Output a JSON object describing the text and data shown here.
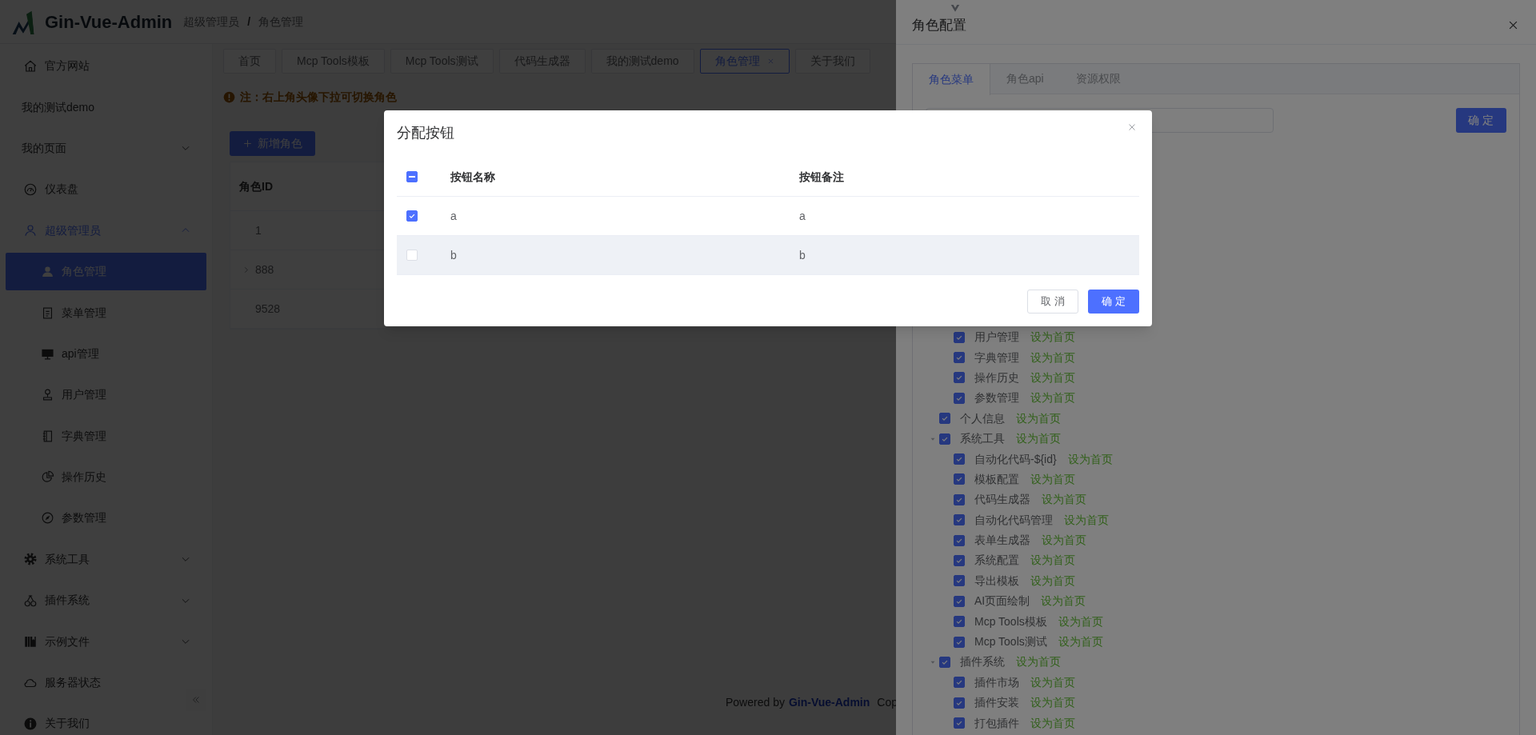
{
  "header": {
    "app_name": "Gin-Vue-Admin",
    "breadcrumb": [
      "超级管理员",
      "角色管理"
    ],
    "separator": "/"
  },
  "sidebar": {
    "items": [
      {
        "label": "官方网站"
      },
      {
        "label": "我的测试demo"
      },
      {
        "label": "我的页面",
        "expanded": false
      },
      {
        "label": "仪表盘"
      },
      {
        "label": "超级管理员",
        "expanded": true,
        "children": [
          {
            "label": "角色管理",
            "selected": true
          },
          {
            "label": "菜单管理",
            "selected": false
          },
          {
            "label": "api管理",
            "selected": false
          },
          {
            "label": "用户管理",
            "selected": false
          },
          {
            "label": "字典管理",
            "selected": false
          },
          {
            "label": "操作历史",
            "selected": false
          },
          {
            "label": "参数管理",
            "selected": false
          }
        ]
      },
      {
        "label": "系统工具",
        "expanded": false
      },
      {
        "label": "插件系统",
        "expanded": false
      },
      {
        "label": "示例文件",
        "expanded": false
      },
      {
        "label": "服务器状态"
      },
      {
        "label": "关于我们"
      }
    ]
  },
  "tabs": [
    {
      "label": "首页",
      "selected": false,
      "closable": false
    },
    {
      "label": "Mcp Tools模板",
      "selected": false,
      "closable": false
    },
    {
      "label": "Mcp Tools测试",
      "selected": false,
      "closable": false
    },
    {
      "label": "代码生成器",
      "selected": false,
      "closable": false
    },
    {
      "label": "我的测试demo",
      "selected": false,
      "closable": false
    },
    {
      "label": "角色管理",
      "selected": true,
      "closable": true
    },
    {
      "label": "关于我们",
      "selected": false,
      "closable": false
    }
  ],
  "notice": "注：右上角头像下拉可切换角色",
  "add_button": "新增角色",
  "roles_table": {
    "columns": [
      "角色ID"
    ],
    "rows": [
      {
        "id": "1",
        "expandable": false
      },
      {
        "id": "888",
        "expandable": true
      },
      {
        "id": "9528",
        "expandable": false
      }
    ]
  },
  "footer": {
    "prefix": "Powered by",
    "link": "Gin-Vue-Admin",
    "suffix": "Cop"
  },
  "drawer": {
    "title": "角色配置",
    "tabs": [
      {
        "label": "角色菜单",
        "selected": true
      },
      {
        "label": "角色api",
        "selected": false
      },
      {
        "label": "资源权限",
        "selected": false
      }
    ],
    "confirm": "确定",
    "tree": [
      {
        "children": [
          {
            "label": "用户管理",
            "checked": true,
            "action": "设为首页"
          },
          {
            "label": "字典管理",
            "checked": true,
            "action": "设为首页"
          },
          {
            "label": "操作历史",
            "checked": true,
            "action": "设为首页"
          },
          {
            "label": "参数管理",
            "checked": true,
            "action": "设为首页"
          }
        ]
      },
      {
        "label": "个人信息",
        "checked": true,
        "action": "设为首页"
      },
      {
        "label": "系统工具",
        "checked": true,
        "action": "设为首页",
        "expanded": true,
        "children": [
          {
            "label": "自动化代码-${id}",
            "checked": true,
            "action": "设为首页"
          },
          {
            "label": "模板配置",
            "checked": true,
            "action": "设为首页"
          },
          {
            "label": "代码生成器",
            "checked": true,
            "action": "设为首页"
          },
          {
            "label": "自动化代码管理",
            "checked": true,
            "action": "设为首页"
          },
          {
            "label": "表单生成器",
            "checked": true,
            "action": "设为首页"
          },
          {
            "label": "系统配置",
            "checked": true,
            "action": "设为首页"
          },
          {
            "label": "导出模板",
            "checked": true,
            "action": "设为首页"
          },
          {
            "label": "AI页面绘制",
            "checked": true,
            "action": "设为首页"
          },
          {
            "label": "Mcp Tools模板",
            "checked": true,
            "action": "设为首页"
          },
          {
            "label": "Mcp Tools测试",
            "checked": true,
            "action": "设为首页"
          }
        ]
      },
      {
        "label": "插件系统",
        "checked": true,
        "action": "设为首页",
        "expanded": true,
        "children": [
          {
            "label": "插件市场",
            "checked": true,
            "action": "设为首页"
          },
          {
            "label": "插件安装",
            "checked": true,
            "action": "设为首页"
          },
          {
            "label": "打包插件",
            "checked": true,
            "action": "设为首页"
          }
        ]
      }
    ]
  },
  "dialog": {
    "title": "分配按钮",
    "select_all": {
      "indeterminate": true
    },
    "columns": [
      "按钮名称",
      "按钮备注"
    ],
    "rows": [
      {
        "name": "a",
        "note": "a",
        "checked": true,
        "hovered": false
      },
      {
        "name": "b",
        "note": "b",
        "checked": false,
        "hovered": true
      }
    ],
    "cancel": "取消",
    "confirm": "确定"
  }
}
